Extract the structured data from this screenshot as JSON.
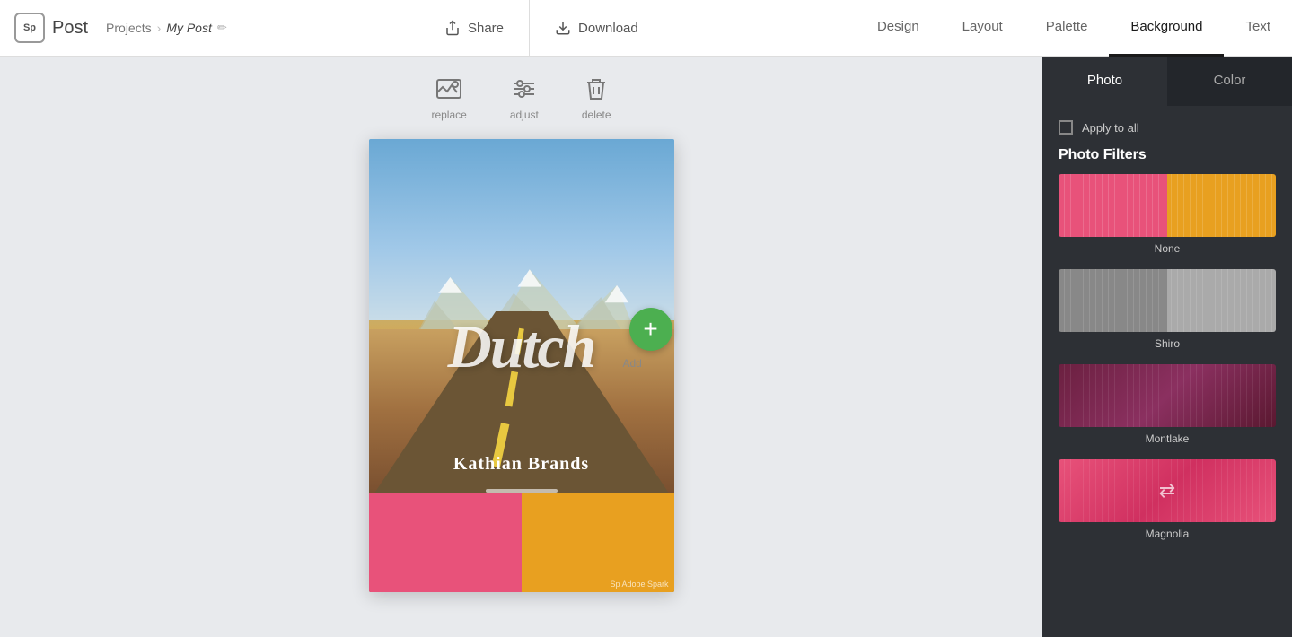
{
  "logo": {
    "box_text": "Sp",
    "app_name": "Post"
  },
  "breadcrumb": {
    "parent": "Projects",
    "separator": "›",
    "current": "My Post"
  },
  "header": {
    "share_label": "Share",
    "download_label": "Download",
    "nav_items": [
      {
        "id": "design",
        "label": "Design",
        "active": false
      },
      {
        "id": "layout",
        "label": "Layout",
        "active": false
      },
      {
        "id": "palette",
        "label": "Palette",
        "active": false
      },
      {
        "id": "background",
        "label": "Background",
        "active": true
      },
      {
        "id": "text",
        "label": "Text",
        "active": false
      }
    ]
  },
  "toolbar": {
    "replace_label": "replace",
    "adjust_label": "adjust",
    "delete_label": "delete"
  },
  "canvas": {
    "title_line1": "Dutch",
    "title_line2": "Kathian Brands",
    "watermark": "Sp Adobe Spark",
    "add_label": "Add"
  },
  "right_panel": {
    "tab_photo": "Photo",
    "tab_color": "Color",
    "apply_to_all_label": "Apply to all",
    "filters_heading": "Photo Filters",
    "filters": [
      {
        "id": "none",
        "label": "None",
        "swatch_class": "swatch-none"
      },
      {
        "id": "shiro",
        "label": "Shiro",
        "swatch_class": "swatch-shiro"
      },
      {
        "id": "montlake",
        "label": "Montlake",
        "swatch_class": "swatch-montlake"
      },
      {
        "id": "magnolia",
        "label": "Magnolia",
        "swatch_class": "swatch-magnolia"
      }
    ]
  }
}
